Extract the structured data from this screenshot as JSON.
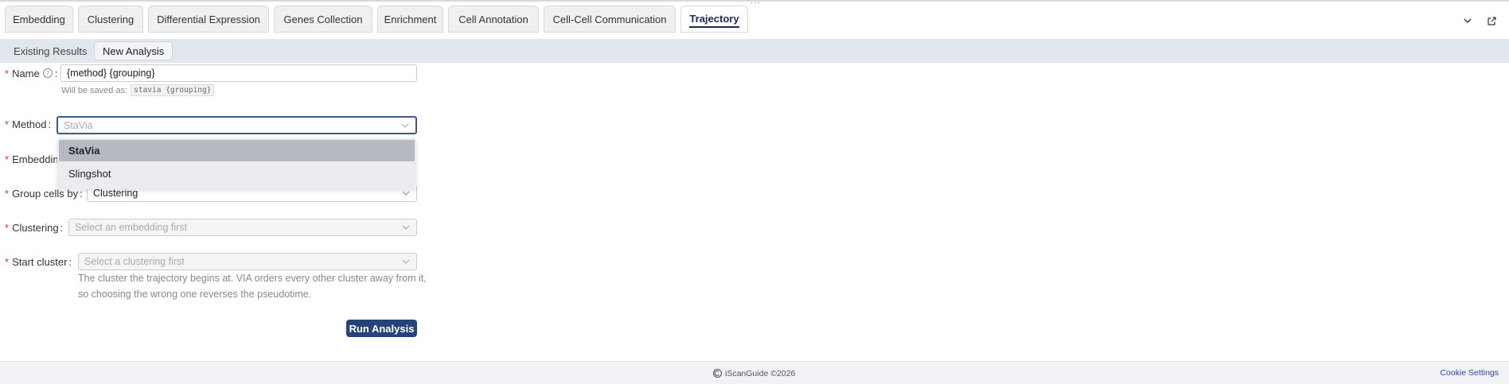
{
  "tabs": [
    {
      "label": "Embedding",
      "active": false
    },
    {
      "label": "Clustering",
      "active": false
    },
    {
      "label": "Differential Expression",
      "active": false
    },
    {
      "label": "Genes Collection",
      "active": false
    },
    {
      "label": "Enrichment",
      "active": false
    },
    {
      "label": "Cell Annotation",
      "active": false
    },
    {
      "label": "Cell-Cell Communication",
      "active": false
    },
    {
      "label": "Trajectory",
      "active": true
    }
  ],
  "subtabs": [
    {
      "label": "Existing Results",
      "active": false
    },
    {
      "label": "New Analysis",
      "active": true
    }
  ],
  "form": {
    "name": {
      "label": "Name",
      "value": "{method} {grouping}",
      "hint_prefix": "Will be saved as:",
      "hint_code": "stavia {grouping}"
    },
    "method": {
      "label": "Method",
      "value": "StaVia",
      "options": [
        "StaVia",
        "Slingshot"
      ],
      "selected_option": "StaVia"
    },
    "embedding": {
      "label": "Embeddin"
    },
    "group_cells_by": {
      "label": "Group cells by",
      "value": "Clustering"
    },
    "clustering": {
      "label": "Clustering",
      "placeholder": "Select an embedding first"
    },
    "start_cluster": {
      "label": "Start cluster",
      "placeholder": "Select a clustering first",
      "description": "The cluster the trajectory begins at. VIA orders every other cluster away from it, so choosing the wrong one reverses the pseudotime."
    },
    "run_label": "Run Analysis"
  },
  "footer": {
    "copyright": "iScanGuide ©2026",
    "cookie_label": "Cookie Settings"
  },
  "colors": {
    "accent": "#27447a",
    "active_tab_text": "#1a2a55",
    "required": "#e03030"
  }
}
